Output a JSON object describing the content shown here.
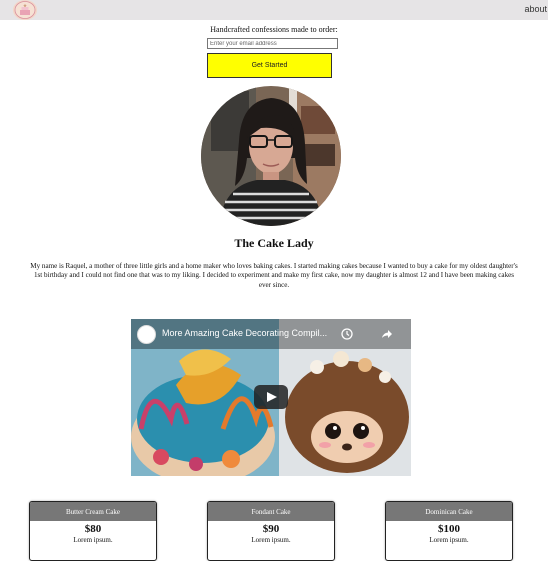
{
  "nav": {
    "logo_icon": "cake-logo-icon",
    "about_label": "about"
  },
  "signup": {
    "label": "Handcrafted confessions made to order:",
    "email_placeholder": "Enter your email address",
    "button_label": "Get Started",
    "button_color": "#ffff00"
  },
  "bio": {
    "title": "The Cake Lady",
    "text": "My name is Raquel, a mother of three little girls and a home maker who loves baking cakes. I started making cakes because I wanted to buy a cake for my oldest daughter's 1st birthday and I could not find one that was to my liking. I decided to experiment and make my first cake, now my daughter is almost 12 and I have been making cakes ever since."
  },
  "video": {
    "title": "More Amazing Cake Decorating Compil...",
    "play_icon": "play-icon",
    "watch_later_icon": "clock-icon",
    "share_icon": "share-icon"
  },
  "cards": [
    {
      "name": "Butter Cream Cake",
      "price": "$80",
      "desc": "Lorem ipsum."
    },
    {
      "name": "Fondant Cake",
      "price": "$90",
      "desc": "Lorem ipsum."
    },
    {
      "name": "Dominican Cake",
      "price": "$100",
      "desc": "Lorem ipsum."
    }
  ]
}
